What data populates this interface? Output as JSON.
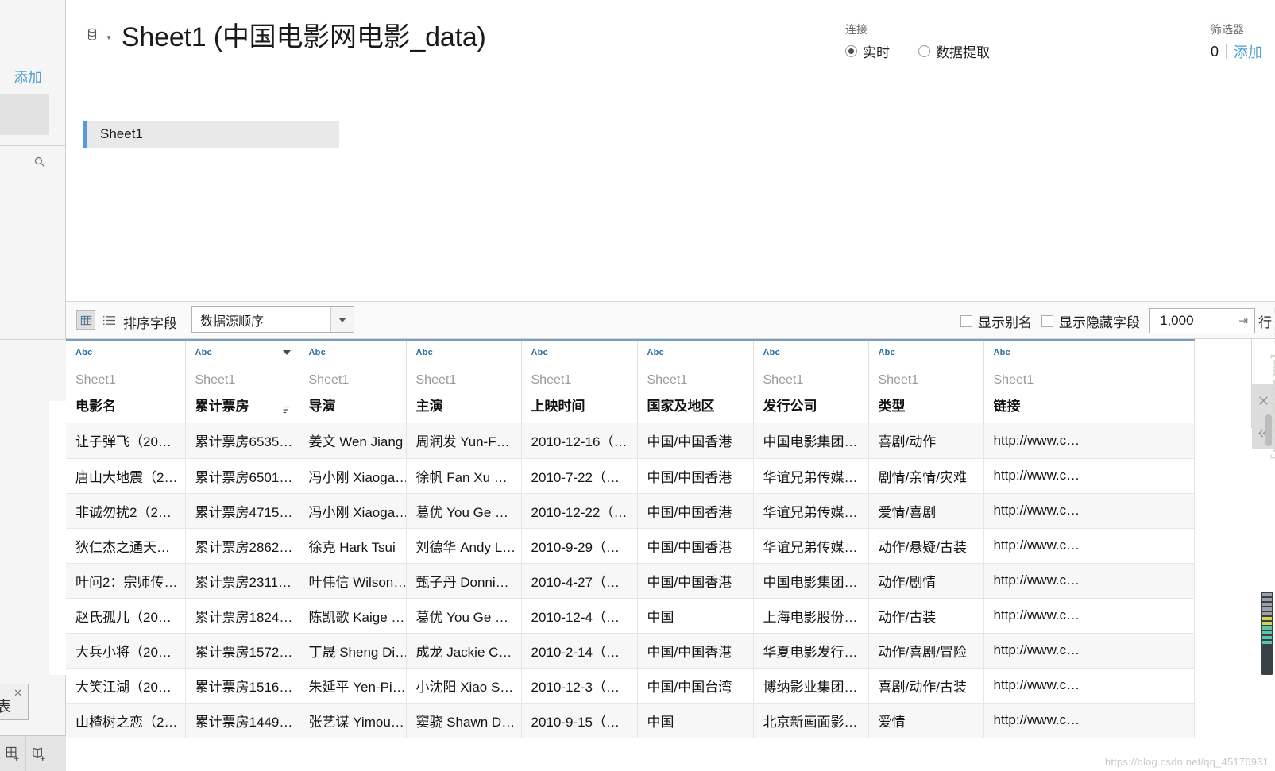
{
  "left_rail": {
    "add_label": "添加",
    "search_icon": "search-icon",
    "sheet_tab_label": "表",
    "close_icon": "close-icon",
    "new_sheet_icon": "new-worksheet-icon",
    "new_story_icon": "new-story-icon"
  },
  "header": {
    "db_icon": "database-icon",
    "title": "Sheet1 (中国电影网电影_data)",
    "connection": {
      "label": "连接",
      "options": [
        {
          "label": "实时",
          "selected": true
        },
        {
          "label": "数据提取",
          "selected": false
        }
      ]
    },
    "filters": {
      "label": "筛选器",
      "count": "0",
      "add_label": "添加"
    },
    "sheet_chip": "Sheet1"
  },
  "toolbar": {
    "grid_view_icon": "grid-view-icon",
    "list_view_icon": "list-view-icon",
    "sort_label": "排序字段",
    "sort_value": "数据源顺序",
    "show_alias_label": "显示别名",
    "show_alias_checked": false,
    "show_hidden_label": "显示隐藏字段",
    "show_hidden_checked": false,
    "row_limit_value": "1,000",
    "row_word": "行"
  },
  "grid": {
    "type_tag": "Abc",
    "source_label": "Sheet1",
    "columns": [
      {
        "name": "电影名",
        "has_caret": false,
        "has_sort": false
      },
      {
        "name": "累计票房",
        "has_caret": true,
        "has_sort": true
      },
      {
        "name": "导演",
        "has_caret": false,
        "has_sort": false
      },
      {
        "name": "主演",
        "has_caret": false,
        "has_sort": false
      },
      {
        "name": "上映时间",
        "has_caret": false,
        "has_sort": false
      },
      {
        "name": "国家及地区",
        "has_caret": false,
        "has_sort": false
      },
      {
        "name": "发行公司",
        "has_caret": false,
        "has_sort": false
      },
      {
        "name": "类型",
        "has_caret": false,
        "has_sort": false
      },
      {
        "name": "链接",
        "has_caret": false,
        "has_sort": false
      }
    ],
    "rows": [
      [
        "让子弹飞（20…",
        "累计票房6535…",
        "姜文 Wen Jiang",
        "周润发 Yun-F…",
        "2010-12-16（…",
        "中国/中国香港",
        "中国电影集团…",
        "喜剧/动作",
        "http://www.c…"
      ],
      [
        "唐山大地震（2…",
        "累计票房6501…",
        "冯小刚 Xiaoga…",
        "徐帆 Fan Xu …",
        "2010-7-22（…",
        "中国/中国香港",
        "华谊兄弟传媒…",
        "剧情/亲情/灾难",
        "http://www.c…"
      ],
      [
        "非诚勿扰2（2…",
        "累计票房4715…",
        "冯小刚 Xiaoga…",
        "葛优 You Ge …",
        "2010-12-22（…",
        "中国/中国香港",
        "华谊兄弟传媒…",
        "爱情/喜剧",
        "http://www.c…"
      ],
      [
        "狄仁杰之通天…",
        "累计票房2862…",
        "徐克 Hark Tsui",
        "刘德华 Andy L…",
        "2010-9-29（…",
        "中国/中国香港",
        "华谊兄弟传媒…",
        "动作/悬疑/古装",
        "http://www.c…"
      ],
      [
        "叶问2：宗师传…",
        "累计票房2311…",
        "叶伟信 Wilson…",
        "甄子丹 Donni…",
        "2010-4-27（…",
        "中国/中国香港",
        "中国电影集团…",
        "动作/剧情",
        "http://www.c…"
      ],
      [
        "赵氏孤儿（20…",
        "累计票房1824…",
        "陈凯歌 Kaige …",
        "葛优 You Ge …",
        "2010-12-4（…",
        "中国",
        "上海电影股份…",
        "动作/古装",
        "http://www.c…"
      ],
      [
        "大兵小将（20…",
        "累计票房1572…",
        "丁晟 Sheng Di…",
        "成龙 Jackie C…",
        "2010-2-14（…",
        "中国/中国香港",
        "华夏电影发行…",
        "动作/喜剧/冒险",
        "http://www.c…"
      ],
      [
        "大笑江湖（20…",
        "累计票房1516…",
        "朱延平 Yen-Pi…",
        "小沈阳 Xiao S…",
        "2010-12-3（…",
        "中国/中国台湾",
        "博纳影业集团…",
        "喜剧/动作/古装",
        "http://www.c…"
      ],
      [
        "山楂树之恋（2…",
        "累计票房1449…",
        "张艺谋 Yimou…",
        "窦骁 Shawn D…",
        "2010-9-15（…",
        "中国",
        "北京新画面影…",
        "爱情",
        "http://www.c…"
      ]
    ]
  },
  "right_panel": {
    "close_icon": "close-icon",
    "collapse_icon": "double-chevron-left-icon"
  },
  "overlay": {
    "ditto_label": "Ditto [最顶层窗口]",
    "watermark": "https://blog.csdn.net/qq_45176931"
  },
  "colors": {
    "accent_blue": "#4e9fd1",
    "header_rule": "#7a9ec0",
    "abc_blue": "#2c6e9e",
    "chip_bar": "#5b9bd5"
  }
}
